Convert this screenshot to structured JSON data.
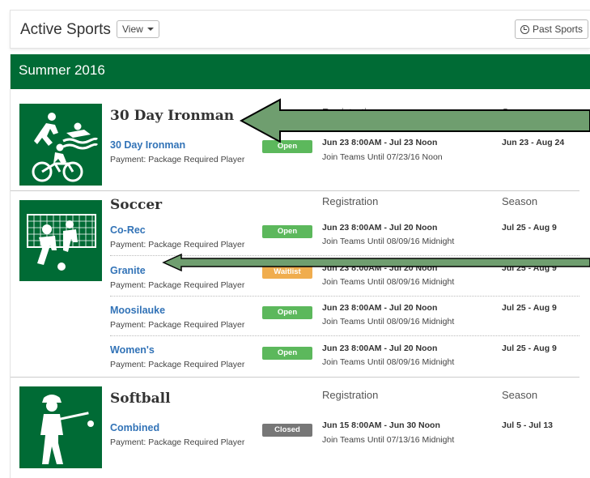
{
  "header": {
    "title": "Active Sports",
    "view_label": "View",
    "past_sports_label": "Past Sports"
  },
  "season": {
    "name": "Summer 2016"
  },
  "columns": {
    "registration": "Registration",
    "season": "Season"
  },
  "sports": [
    {
      "name": "30 Day Ironman",
      "icon": "triathlon-icon",
      "leagues": [
        {
          "name": "30 Day Ironman",
          "payment": "Payment: Package Required Player",
          "status": "Open",
          "registration": "Jun 23 8:00AM - Jul 23 Noon",
          "join": "Join Teams Until 07/23/16 Noon",
          "season": "Jun 23 - Aug 24"
        }
      ]
    },
    {
      "name": "Soccer",
      "icon": "soccer-icon",
      "leagues": [
        {
          "name": "Co-Rec",
          "payment": "Payment: Package Required Player",
          "status": "Open",
          "registration": "Jun 23 8:00AM - Jul 20 Noon",
          "join": "Join Teams Until 08/09/16 Midnight",
          "season": "Jul 25 - Aug 9"
        },
        {
          "name": "Granite",
          "payment": "Payment: Package Required Player",
          "status": "Waitlist",
          "registration": "Jun 23 8:00AM - Jul 20 Noon",
          "join": "Join Teams Until 08/09/16 Midnight",
          "season": "Jul 25 - Aug 9"
        },
        {
          "name": "Moosilauke",
          "payment": "Payment: Package Required Player",
          "status": "Open",
          "registration": "Jun 23 8:00AM - Jul 20 Noon",
          "join": "Join Teams Until 08/09/16 Midnight",
          "season": "Jul 25 - Aug 9"
        },
        {
          "name": "Women's",
          "payment": "Payment: Package Required Player",
          "status": "Open",
          "registration": "Jun 23 8:00AM - Jul 20 Noon",
          "join": "Join Teams Until 08/09/16 Midnight",
          "season": "Jul 25 - Aug 9"
        }
      ]
    },
    {
      "name": "Softball",
      "icon": "baseball-batter-icon",
      "leagues": [
        {
          "name": "Combined",
          "payment": "Payment: Package Required Player",
          "status": "Closed",
          "registration": "Jun 15 8:00AM - Jun 30 Noon",
          "join": "Join Teams Until 07/13/16 Midnight",
          "season": "Jul 5 - Jul 13"
        }
      ]
    }
  ],
  "colors": {
    "brand_green": "#006b35",
    "link_blue": "#3273b7",
    "open_green": "#5cb85c",
    "waitlist_orange": "#f0ad4e",
    "closed_gray": "#777777",
    "annotation_arrow": "#6f9e6f"
  }
}
